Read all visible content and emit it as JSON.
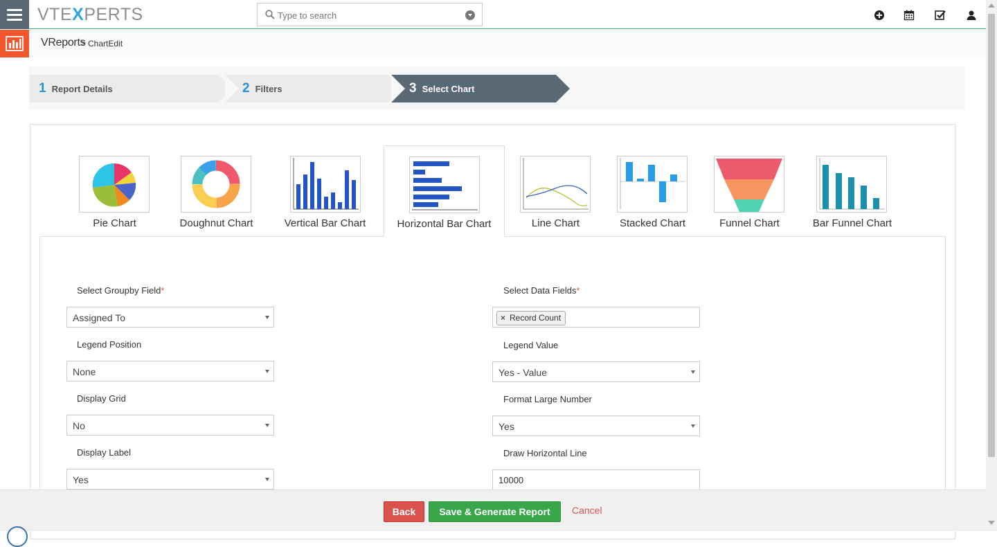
{
  "header": {
    "logo": {
      "part1": "VTE",
      "part2": "X",
      "part3": "PERTS"
    },
    "search": {
      "placeholder": "Type to search"
    },
    "icons": [
      "add-icon",
      "calendar-icon",
      "tasks-icon",
      "user-icon"
    ]
  },
  "breadcrumb": {
    "module": "VReports",
    "separator": ">",
    "page": "ChartEdit"
  },
  "wizard": {
    "steps": [
      {
        "num": "1",
        "label": "Report Details"
      },
      {
        "num": "2",
        "label": "Filters"
      },
      {
        "num": "3",
        "label": "Select Chart"
      }
    ],
    "active_step": 3
  },
  "chart_tabs": [
    {
      "label": "Pie Chart"
    },
    {
      "label": "Doughnut Chart"
    },
    {
      "label": "Vertical Bar Chart"
    },
    {
      "label": "Horizontal Bar Chart"
    },
    {
      "label": "Line Chart"
    },
    {
      "label": "Stacked Chart"
    },
    {
      "label": "Funnel Chart"
    },
    {
      "label": "Bar Funnel Chart"
    }
  ],
  "active_chart_tab": "Horizontal Bar Chart",
  "form": {
    "groupby": {
      "label": "Select Groupby Field",
      "required": "*",
      "value": "Assigned To"
    },
    "data_fields": {
      "label": "Select Data Fields",
      "required": "*",
      "tags": [
        "Record Count"
      ],
      "remove": "×"
    },
    "legend_position": {
      "label": "Legend Position",
      "value": "None"
    },
    "legend_value": {
      "label": "Legend Value",
      "value": "Yes - Value"
    },
    "display_grid": {
      "label": "Display Grid",
      "value": "No"
    },
    "format_large_number": {
      "label": "Format Large Number",
      "value": "Yes"
    },
    "display_label": {
      "label": "Display Label",
      "value": "Yes"
    },
    "draw_horizontal_line": {
      "label": "Draw Horizontal Line",
      "value": "10000"
    }
  },
  "footer": {
    "back": "Back",
    "save": "Save & Generate Report",
    "cancel": "Cancel"
  },
  "colors": {
    "accent_green": "#3aa64a",
    "danger_red": "#d9534f",
    "nav_slate": "#596875",
    "module_orange": "#f1562d",
    "step_blue": "#2a92d4"
  }
}
